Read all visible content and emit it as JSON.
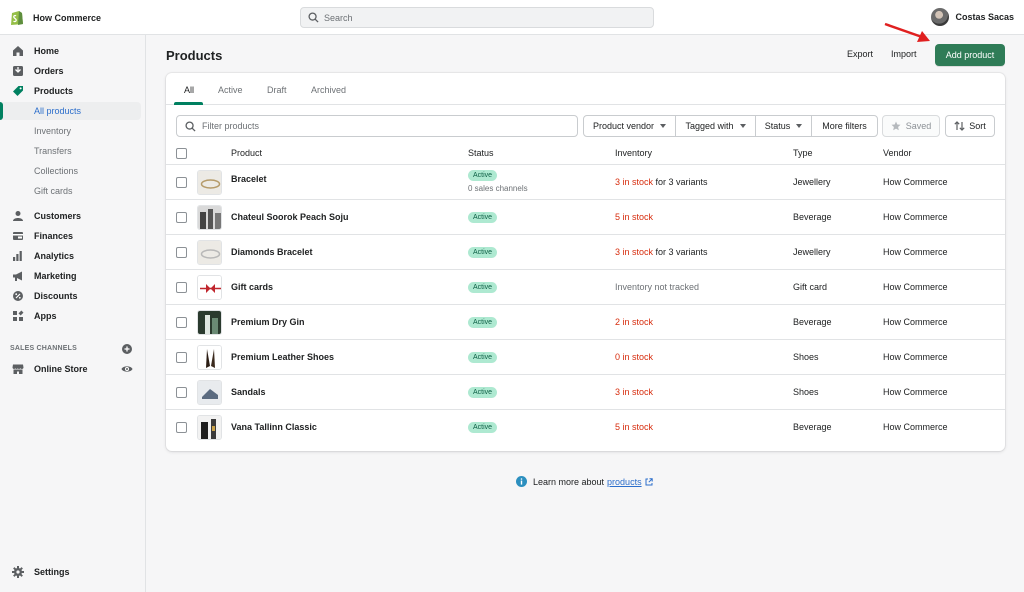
{
  "topbar": {
    "store_name": "How Commerce",
    "search_placeholder": "Search",
    "user_name": "Costas Sacas"
  },
  "sidebar": {
    "items": [
      {
        "label": "Home",
        "icon": "home-icon"
      },
      {
        "label": "Orders",
        "icon": "orders-icon"
      },
      {
        "label": "Products",
        "icon": "tag-icon"
      },
      {
        "label": "Customers",
        "icon": "person-icon"
      },
      {
        "label": "Finances",
        "icon": "finances-icon"
      },
      {
        "label": "Analytics",
        "icon": "analytics-icon"
      },
      {
        "label": "Marketing",
        "icon": "megaphone-icon"
      },
      {
        "label": "Discounts",
        "icon": "discount-icon"
      },
      {
        "label": "Apps",
        "icon": "apps-icon"
      }
    ],
    "product_subitems": [
      "All products",
      "Inventory",
      "Transfers",
      "Collections",
      "Gift cards"
    ],
    "sales_channels_title": "SALES CHANNELS",
    "online_store": "Online Store",
    "settings": "Settings"
  },
  "page": {
    "title": "Products",
    "export": "Export",
    "import": "Import",
    "add_product": "Add product"
  },
  "tabs": [
    "All",
    "Active",
    "Draft",
    "Archived"
  ],
  "filters": {
    "placeholder": "Filter products",
    "product_vendor": "Product vendor",
    "tagged_with": "Tagged with",
    "status": "Status",
    "more_filters": "More filters",
    "saved": "Saved",
    "sort": "Sort"
  },
  "table": {
    "headers": [
      "Product",
      "Status",
      "Inventory",
      "Type",
      "Vendor"
    ],
    "rows": [
      {
        "name": "Bracelet",
        "status": "Active",
        "channels": "0 sales channels",
        "inv_main": "3 in stock",
        "inv_rest": " for 3 variants",
        "inv_style": "red",
        "type": "Jewellery",
        "vendor": "How Commerce"
      },
      {
        "name": "Chateul Soorok Peach Soju",
        "status": "Active",
        "channels": "",
        "inv_main": "5 in stock",
        "inv_rest": "",
        "inv_style": "red",
        "type": "Beverage",
        "vendor": "How Commerce"
      },
      {
        "name": "Diamonds Bracelet",
        "status": "Active",
        "channels": "",
        "inv_main": "3 in stock",
        "inv_rest": " for 3 variants",
        "inv_style": "red",
        "type": "Jewellery",
        "vendor": "How Commerce"
      },
      {
        "name": "Gift cards",
        "status": "Active",
        "channels": "",
        "inv_main": "Inventory not tracked",
        "inv_rest": "",
        "inv_style": "muted",
        "type": "Gift card",
        "vendor": "How Commerce"
      },
      {
        "name": "Premium Dry Gin",
        "status": "Active",
        "channels": "",
        "inv_main": "2 in stock",
        "inv_rest": "",
        "inv_style": "red",
        "type": "Beverage",
        "vendor": "How Commerce"
      },
      {
        "name": "Premium Leather Shoes",
        "status": "Active",
        "channels": "",
        "inv_main": "0 in stock",
        "inv_rest": "",
        "inv_style": "red",
        "type": "Shoes",
        "vendor": "How Commerce"
      },
      {
        "name": "Sandals",
        "status": "Active",
        "channels": "",
        "inv_main": "3 in stock",
        "inv_rest": "",
        "inv_style": "red",
        "type": "Shoes",
        "vendor": "How Commerce"
      },
      {
        "name": "Vana Tallinn Classic",
        "status": "Active",
        "channels": "",
        "inv_main": "5 in stock",
        "inv_rest": "",
        "inv_style": "red",
        "type": "Beverage",
        "vendor": "How Commerce"
      }
    ]
  },
  "footer": {
    "text": "Learn more about",
    "link": "products"
  },
  "colors": {
    "primary": "#2f7c57",
    "active_badge_bg": "#aee9d1",
    "critical_text": "#d72c0d",
    "link": "#2c6ecb"
  }
}
